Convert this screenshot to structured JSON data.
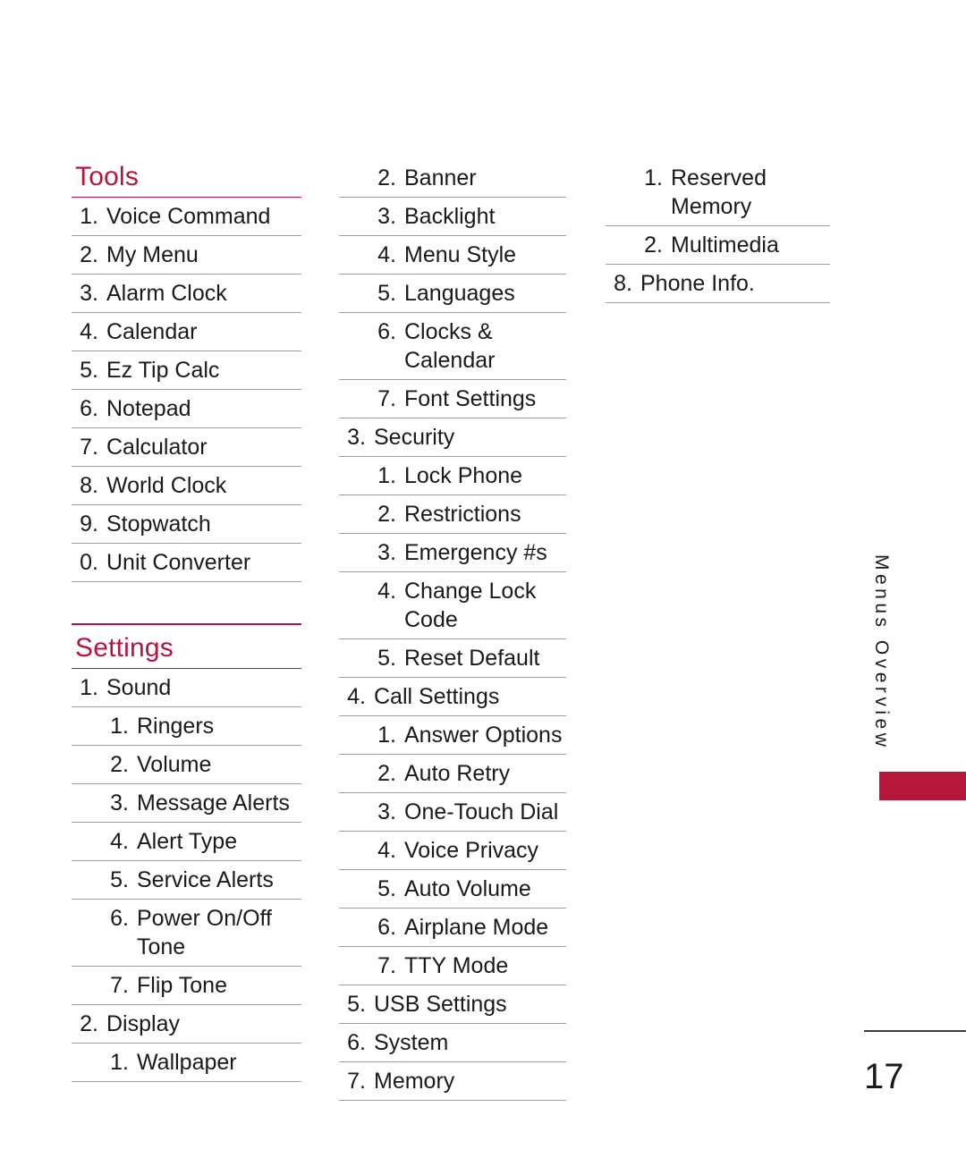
{
  "page": {
    "number": "17",
    "side_tab_label": "Menus Overview",
    "accent_color": "#b4163c",
    "rule_color": "#9d9d9d"
  },
  "columns": [
    {
      "name": "column-1",
      "blocks": [
        {
          "type": "section",
          "heading": "Tools",
          "top_rule": false,
          "items": [
            {
              "level": 1,
              "num": "1.",
              "label": "Voice Command"
            },
            {
              "level": 1,
              "num": "2.",
              "label": "My Menu"
            },
            {
              "level": 1,
              "num": "3.",
              "label": "Alarm Clock"
            },
            {
              "level": 1,
              "num": "4.",
              "label": "Calendar"
            },
            {
              "level": 1,
              "num": "5.",
              "label": "Ez Tip Calc"
            },
            {
              "level": 1,
              "num": "6.",
              "label": "Notepad"
            },
            {
              "level": 1,
              "num": "7.",
              "label": "Calculator"
            },
            {
              "level": 1,
              "num": "8.",
              "label": "World Clock"
            },
            {
              "level": 1,
              "num": "9.",
              "label": "Stopwatch"
            },
            {
              "level": 1,
              "num": "0.",
              "label": "Unit Converter"
            }
          ]
        },
        {
          "type": "gap"
        },
        {
          "type": "section",
          "heading": "Settings",
          "top_rule": true,
          "items": [
            {
              "level": 1,
              "num": "1.",
              "label": "Sound"
            },
            {
              "level": 2,
              "num": "1.",
              "label": "Ringers"
            },
            {
              "level": 2,
              "num": "2.",
              "label": "Volume"
            },
            {
              "level": 2,
              "num": "3.",
              "label": "Message Alerts"
            },
            {
              "level": 2,
              "num": "4.",
              "label": "Alert Type"
            },
            {
              "level": 2,
              "num": "5.",
              "label": "Service Alerts"
            },
            {
              "level": 2,
              "num": "6.",
              "label": "Power On/Off Tone"
            },
            {
              "level": 2,
              "num": "7.",
              "label": "Flip Tone"
            },
            {
              "level": 1,
              "num": "2.",
              "label": "Display"
            },
            {
              "level": 2,
              "num": "1.",
              "label": "Wallpaper"
            }
          ]
        }
      ]
    },
    {
      "name": "column-2",
      "blocks": [
        {
          "type": "list",
          "items": [
            {
              "level": 2,
              "num": "2.",
              "label": "Banner"
            },
            {
              "level": 2,
              "num": "3.",
              "label": "Backlight"
            },
            {
              "level": 2,
              "num": "4.",
              "label": "Menu Style"
            },
            {
              "level": 2,
              "num": "5.",
              "label": "Languages"
            },
            {
              "level": 2,
              "num": "6.",
              "label": "Clocks & Calendar"
            },
            {
              "level": 2,
              "num": "7.",
              "label": "Font Settings"
            },
            {
              "level": 1,
              "num": "3.",
              "label": "Security"
            },
            {
              "level": 2,
              "num": "1.",
              "label": "Lock Phone"
            },
            {
              "level": 2,
              "num": "2.",
              "label": "Restrictions"
            },
            {
              "level": 2,
              "num": "3.",
              "label": "Emergency #s"
            },
            {
              "level": 2,
              "num": "4.",
              "label": "Change Lock Code"
            },
            {
              "level": 2,
              "num": "5.",
              "label": "Reset Default"
            },
            {
              "level": 1,
              "num": "4.",
              "label": "Call Settings"
            },
            {
              "level": 2,
              "num": "1.",
              "label": "Answer Options"
            },
            {
              "level": 2,
              "num": "2.",
              "label": "Auto Retry"
            },
            {
              "level": 2,
              "num": "3.",
              "label": "One-Touch Dial"
            },
            {
              "level": 2,
              "num": "4.",
              "label": "Voice Privacy"
            },
            {
              "level": 2,
              "num": "5.",
              "label": "Auto Volume"
            },
            {
              "level": 2,
              "num": "6.",
              "label": "Airplane Mode"
            },
            {
              "level": 2,
              "num": "7.",
              "label": "TTY Mode"
            },
            {
              "level": 1,
              "num": "5.",
              "label": "USB Settings"
            },
            {
              "level": 1,
              "num": "6.",
              "label": "System"
            },
            {
              "level": 1,
              "num": "7.",
              "label": "Memory"
            }
          ]
        }
      ]
    },
    {
      "name": "column-3",
      "blocks": [
        {
          "type": "list",
          "items": [
            {
              "level": 2,
              "num": "1.",
              "label": "Reserved Memory"
            },
            {
              "level": 2,
              "num": "2.",
              "label": "Multimedia"
            },
            {
              "level": 1,
              "num": "8.",
              "label": "Phone Info."
            }
          ]
        }
      ]
    }
  ]
}
